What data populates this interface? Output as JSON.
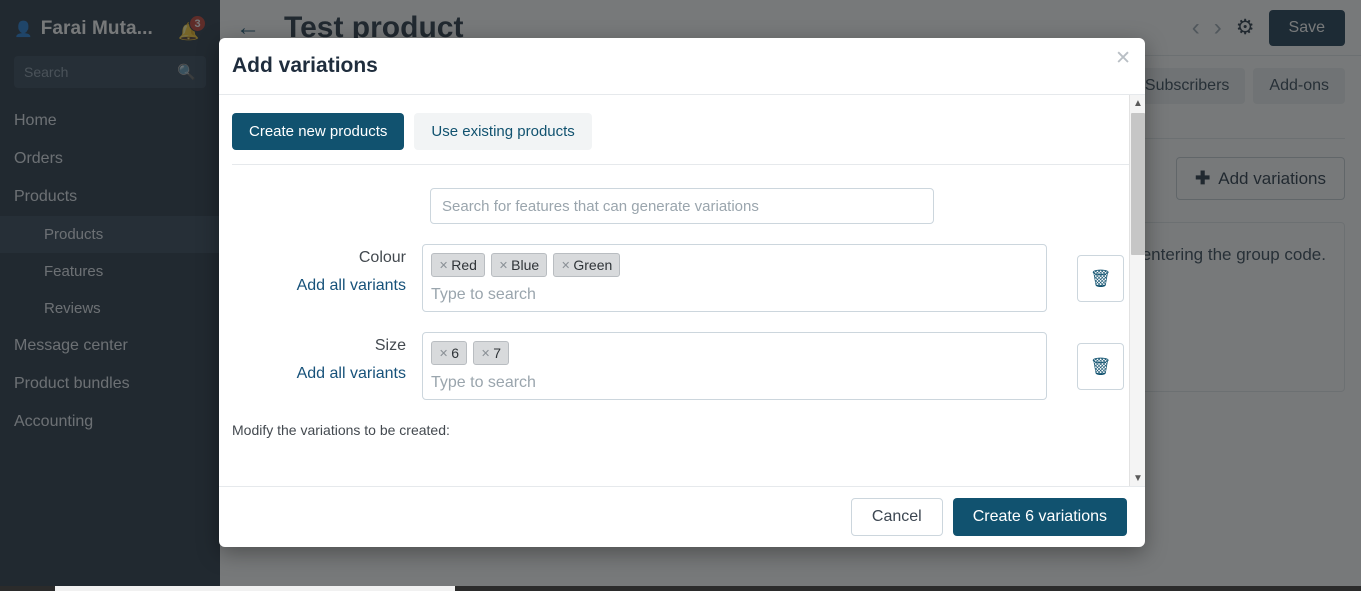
{
  "sidebar": {
    "user": {
      "name": "Farai Muta...",
      "icon": "person-icon",
      "bell_icon": "bell-icon",
      "badge": "3"
    },
    "search": {
      "placeholder": "Search",
      "icon": "search-icon"
    },
    "items": [
      {
        "label": "Home",
        "level": 0,
        "active": false
      },
      {
        "label": "Orders",
        "level": 0,
        "active": false
      },
      {
        "label": "Products",
        "level": 0,
        "active": false
      },
      {
        "label": "Products",
        "level": 1,
        "active": true
      },
      {
        "label": "Features",
        "level": 1,
        "active": false
      },
      {
        "label": "Reviews",
        "level": 1,
        "active": false
      },
      {
        "label": "Message center",
        "level": 0,
        "active": false
      },
      {
        "label": "Product bundles",
        "level": 0,
        "active": false
      },
      {
        "label": "Accounting",
        "level": 0,
        "active": false
      }
    ]
  },
  "topbar": {
    "back_icon": "back-arrow-icon",
    "title": "Test product",
    "prev_icon": "chevron-left-icon",
    "next_icon": "chevron-right-icon",
    "settings_icon": "gear-icon",
    "save_label": "Save"
  },
  "tabs": [
    {
      "label": "Subscribers"
    },
    {
      "label": "Add-ons"
    }
  ],
  "content": {
    "add_variations_label": "Add variations",
    "add_variations_icon": "plus-icon",
    "info_text": "entering the group code."
  },
  "modal": {
    "title": "Add variations",
    "close_icon": "close-icon",
    "segments": [
      {
        "label": "Create new products",
        "selected": true
      },
      {
        "label": "Use existing products",
        "selected": false
      }
    ],
    "feature_search": {
      "value": "",
      "placeholder": "Search for features that can generate variations"
    },
    "attributes": [
      {
        "label": "Colour",
        "link": "Add all variants",
        "tokens": [
          "Red",
          "Blue",
          "Green"
        ],
        "input_placeholder": "Type to search",
        "delete_icon": "trash-icon"
      },
      {
        "label": "Size",
        "link": "Add all variants",
        "tokens": [
          "6",
          "7"
        ],
        "input_placeholder": "Type to search",
        "delete_icon": "trash-icon"
      }
    ],
    "modify_note": "Modify the variations to be created:",
    "scroll": {
      "up_icon": "chevron-up-icon",
      "down_icon": "chevron-down-icon"
    },
    "footer": {
      "cancel_label": "Cancel",
      "create_label": "Create 6 variations"
    }
  },
  "colors": {
    "primary": "#11526f",
    "sidebar_bg": "#1f2d3d",
    "save_btn": "#14344a",
    "badge": "#c0392b",
    "link": "#17527a"
  }
}
